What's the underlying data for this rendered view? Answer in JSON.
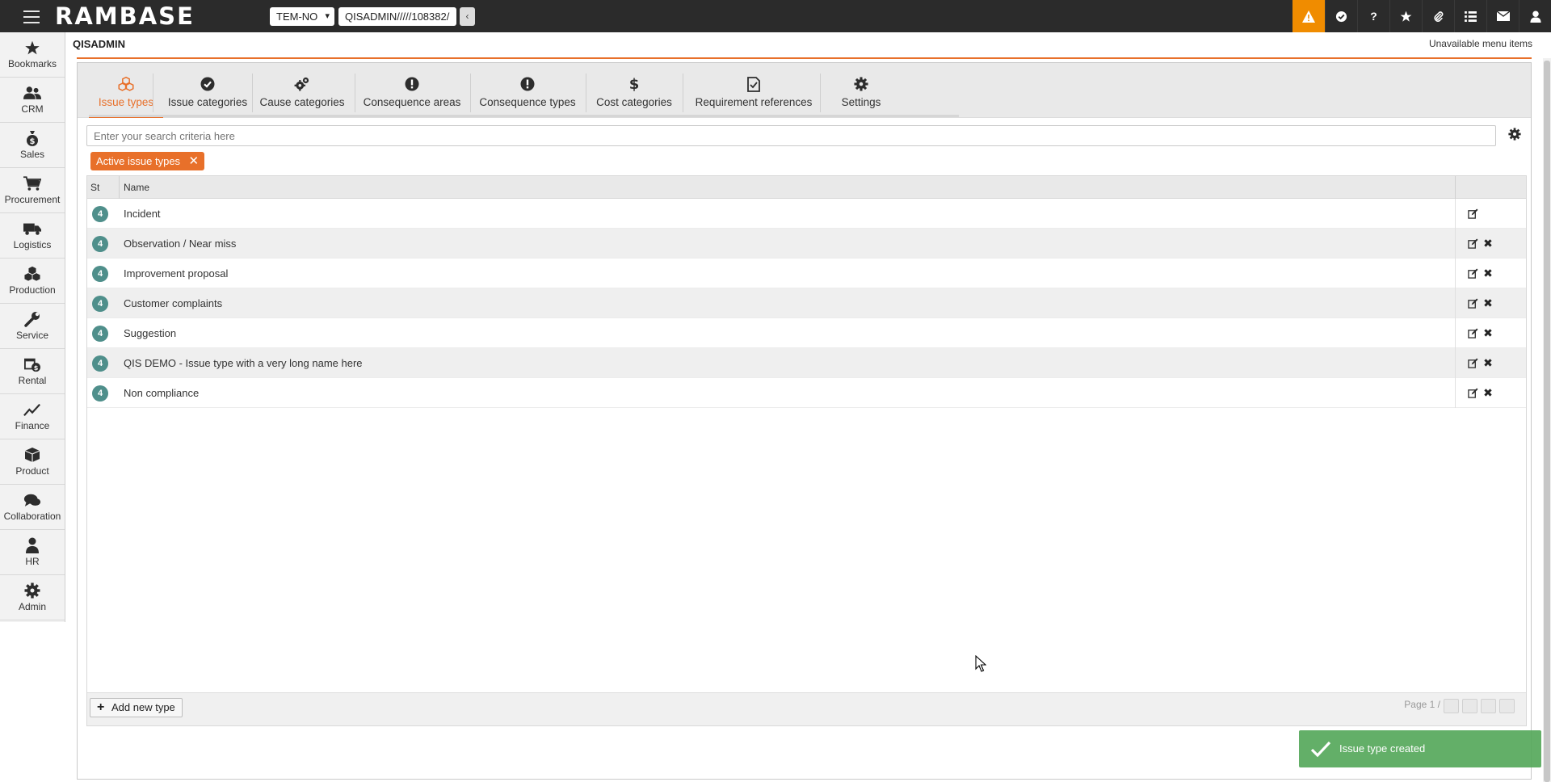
{
  "topbar": {
    "logo": "RAMBASE",
    "company": "TEM-NO",
    "url": "QISADMIN/////108382/",
    "back_label": "‹",
    "icons": [
      "alert-icon",
      "shield-check-icon",
      "help-icon",
      "star-icon",
      "paperclip-icon",
      "list-icon",
      "mail-icon",
      "user-icon"
    ],
    "help_label": "?",
    "alert_color": "#f08c00"
  },
  "nav": {
    "items": [
      {
        "label": "Bookmarks",
        "icon": "star-icon"
      },
      {
        "label": "CRM",
        "icon": "users-icon"
      },
      {
        "label": "Sales",
        "icon": "money-bag-icon"
      },
      {
        "label": "Procurement",
        "icon": "cart-icon"
      },
      {
        "label": "Logistics",
        "icon": "truck-icon"
      },
      {
        "label": "Production",
        "icon": "cubes-icon"
      },
      {
        "label": "Service",
        "icon": "wrench-icon"
      },
      {
        "label": "Rental",
        "icon": "calendar-money-icon"
      },
      {
        "label": "Finance",
        "icon": "line-chart-icon"
      },
      {
        "label": "Product",
        "icon": "box-icon"
      },
      {
        "label": "Collaboration",
        "icon": "chat-icon"
      },
      {
        "label": "HR",
        "icon": "person-icon"
      },
      {
        "label": "Admin",
        "icon": "gear-icon"
      }
    ]
  },
  "header": {
    "title": "QISADMIN",
    "unavailable": "Unavailable menu items",
    "accent": "#e8702a"
  },
  "tabs": [
    {
      "label": "Issue types",
      "icon": "cubes-icon",
      "active": true
    },
    {
      "label": "Issue categories",
      "icon": "check-badge-icon"
    },
    {
      "label": "Cause categories",
      "icon": "cogs-icon"
    },
    {
      "label": "Consequence areas",
      "icon": "exclamation-circle-icon"
    },
    {
      "label": "Consequence types",
      "icon": "exclamation-circle-icon"
    },
    {
      "label": "Cost categories",
      "icon": "dollar-icon"
    },
    {
      "label": "Requirement references",
      "icon": "checklist-icon"
    },
    {
      "label": "Settings",
      "icon": "gear-icon"
    }
  ],
  "search": {
    "placeholder": "Enter your search criteria here"
  },
  "filter": {
    "label": "Active issue types",
    "remove": "✕"
  },
  "table": {
    "columns": [
      "St",
      "Name"
    ],
    "rows": [
      {
        "status": "4",
        "name": "Incident",
        "deletable": false
      },
      {
        "status": "4",
        "name": "Observation / Near miss",
        "deletable": true
      },
      {
        "status": "4",
        "name": "Improvement proposal",
        "deletable": true
      },
      {
        "status": "4",
        "name": "Customer complaints",
        "deletable": true
      },
      {
        "status": "4",
        "name": "Suggestion",
        "deletable": true
      },
      {
        "status": "4",
        "name": "QIS DEMO - Issue type with a very long name here",
        "deletable": true
      },
      {
        "status": "4",
        "name": "Non compliance",
        "deletable": true
      }
    ],
    "status_color": "#4f8f8b",
    "delete_glyph": "✖"
  },
  "footer": {
    "add_label": "Add new type",
    "add_icon": "+",
    "pager": "Page 1 / 1"
  },
  "toast": {
    "message": "Issue type created",
    "color": "#56a85b"
  }
}
